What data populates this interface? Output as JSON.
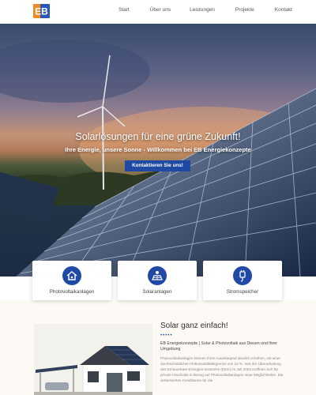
{
  "nav": {
    "logo_text": "EB",
    "links": [
      "Start",
      "Über uns",
      "Leistungen",
      "Projekte",
      "Kontakt"
    ]
  },
  "hero": {
    "title": "Solarlösungen für eine grüne Zukunft!",
    "subtitle": "Ihre Energie, unsere Sonne - Willkommen bei EB Energiekonzepte",
    "cta_label": "Kontaktieren Sie uns!"
  },
  "cards": [
    {
      "label": "Photovoltaikanlagen",
      "icon": "house-icon"
    },
    {
      "label": "Solaranlagen",
      "icon": "solar-panel-icon"
    },
    {
      "label": "Stromspeicher",
      "icon": "plug-icon"
    }
  ],
  "section": {
    "title": "Solar ganz einfach!",
    "dots": "•••••",
    "subtitle": "EB Energiekonzepte | Solar & Photovoltaik aus Diesen und Ihrer Umgebung",
    "body": "Photovoltaikanlagen können Ihren Autarkiegrad deutlich erhöhen, mit einer durchschnittlichen Rekuneabilitätsgrenze von 10 %. Seit der Überarbeitung des Erneuerbare-Energien-Gesetzes (EEG) im Juli 2022 eröffnen sich für private Haushalte in Bezug auf Photovoltaikanlagen neue Möglichkeiten. Die verbesserten Konditionen für die"
  },
  "colors": {
    "accent": "#1e4aa6",
    "logo_orange": "#f08a24",
    "logo_blue": "#2a56b8",
    "section_bg": "#fdfaf5"
  }
}
